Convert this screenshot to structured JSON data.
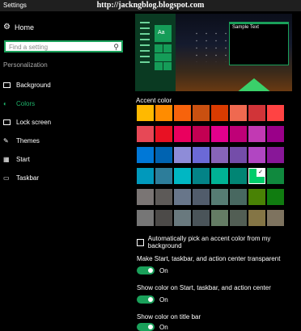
{
  "window": {
    "title": "Settings",
    "watermark": "http://jackngblog.blogspot.com"
  },
  "sidebar": {
    "home_label": "Home",
    "search_placeholder": "Find a setting",
    "section_label": "Personalization",
    "items": [
      {
        "label": "Background",
        "icon": "image-icon",
        "active": false
      },
      {
        "label": "Colors",
        "icon": "palette-icon",
        "active": true
      },
      {
        "label": "Lock screen",
        "icon": "lock-screen-icon",
        "active": false
      },
      {
        "label": "Themes",
        "icon": "brush-icon",
        "active": false
      },
      {
        "label": "Start",
        "icon": "start-icon",
        "active": false
      },
      {
        "label": "Taskbar",
        "icon": "taskbar-icon",
        "active": false
      }
    ]
  },
  "preview": {
    "tile_text": "Aa",
    "sample_text": "Sample Text"
  },
  "accent": {
    "title": "Accent color",
    "selected_index": 30,
    "colors": [
      "#FFB900",
      "#FF8C00",
      "#F7630C",
      "#CA5010",
      "#DA3B01",
      "#EF6950",
      "#D13438",
      "#FF4343",
      "#E74856",
      "#E81123",
      "#EA005E",
      "#C30052",
      "#E3008C",
      "#BF0077",
      "#C239B3",
      "#9A0089",
      "#0078D7",
      "#0063B1",
      "#8E8CD8",
      "#6B69D6",
      "#8764B8",
      "#744DA9",
      "#B146C2",
      "#881798",
      "#0099BC",
      "#2D7D9A",
      "#00B7C3",
      "#038387",
      "#00B294",
      "#018574",
      "#00CC6A",
      "#10893E",
      "#7A7574",
      "#5D5A58",
      "#68768A",
      "#515C6B",
      "#567C73",
      "#486860",
      "#498205",
      "#107C10",
      "#767676",
      "#4C4A48",
      "#69797E",
      "#4A5459",
      "#647C64",
      "#525E54",
      "#847545",
      "#7E735F"
    ]
  },
  "settings": {
    "auto_pick_label": "Automatically pick an accent color from my background",
    "transparent_label": "Make Start, taskbar, and action center transparent",
    "transparent_state": "On",
    "show_color_start_label": "Show color on Start, taskbar, and action center",
    "show_color_start_state": "On",
    "show_color_title_label": "Show color on title bar",
    "show_color_title_state": "On"
  },
  "theme": {
    "accent": "#1AA05A",
    "background": "#000000"
  }
}
